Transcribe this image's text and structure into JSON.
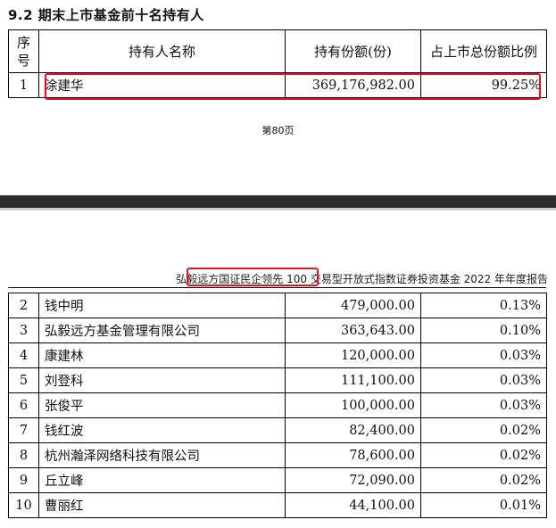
{
  "section": {
    "title": "9.2 期末上市基金前十名持有人"
  },
  "table1": {
    "headers": {
      "seq": "序号",
      "name": "持有人名称",
      "units": "持有份额(份)",
      "ratio": "占上市总份额比例"
    },
    "rows": [
      {
        "seq": "1",
        "name": "涂建华",
        "units": "369,176,982.00",
        "ratio": "99.25%"
      }
    ]
  },
  "page": {
    "number": "第80页"
  },
  "running_header": {
    "fund_name": "弘毅远方国证民企领先 100",
    "rest": " 交易型开放式指数证券投资基金 2022 年年度报告"
  },
  "table2": {
    "rows": [
      {
        "seq": "2",
        "name": "钱中明",
        "units": "479,000.00",
        "ratio": "0.13%"
      },
      {
        "seq": "3",
        "name": "弘毅远方基金管理有限公司",
        "units": "363,643.00",
        "ratio": "0.10%"
      },
      {
        "seq": "4",
        "name": "康建林",
        "units": "120,000.00",
        "ratio": "0.03%"
      },
      {
        "seq": "5",
        "name": "刘登科",
        "units": "111,100.00",
        "ratio": "0.03%"
      },
      {
        "seq": "6",
        "name": "张俊平",
        "units": "100,000.00",
        "ratio": "0.03%"
      },
      {
        "seq": "7",
        "name": "钱红波",
        "units": "82,400.00",
        "ratio": "0.02%"
      },
      {
        "seq": "8",
        "name": "杭州瀚泽网络科技有限公司",
        "units": "78,600.00",
        "ratio": "0.02%"
      },
      {
        "seq": "9",
        "name": "丘立峰",
        "units": "72,090.00",
        "ratio": "0.02%"
      },
      {
        "seq": "10",
        "name": "曹丽红",
        "units": "44,100.00",
        "ratio": "0.01%"
      }
    ]
  },
  "colors": {
    "highlight": "#e0141e",
    "page_gap": "#2b2b2b"
  }
}
